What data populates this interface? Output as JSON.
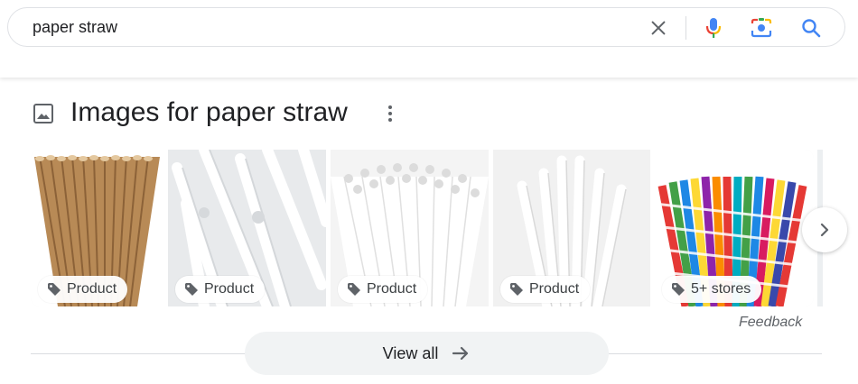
{
  "search": {
    "query": "paper straw"
  },
  "section": {
    "title": "Images for paper straw"
  },
  "images": [
    {
      "chip": "Product",
      "alt": "kraft-straws"
    },
    {
      "chip": "Product",
      "alt": "white-straws-closeup"
    },
    {
      "chip": "Product",
      "alt": "white-straws-bundle"
    },
    {
      "chip": "Product",
      "alt": "white-straws-fan"
    },
    {
      "chip": "5+ stores",
      "alt": "striped-straws"
    }
  ],
  "feedback_label": "Feedback",
  "view_all_label": "View all",
  "colors": {
    "blue": "#4285f4",
    "red": "#ea4335",
    "yellow": "#fbbc04",
    "green": "#34a853"
  }
}
